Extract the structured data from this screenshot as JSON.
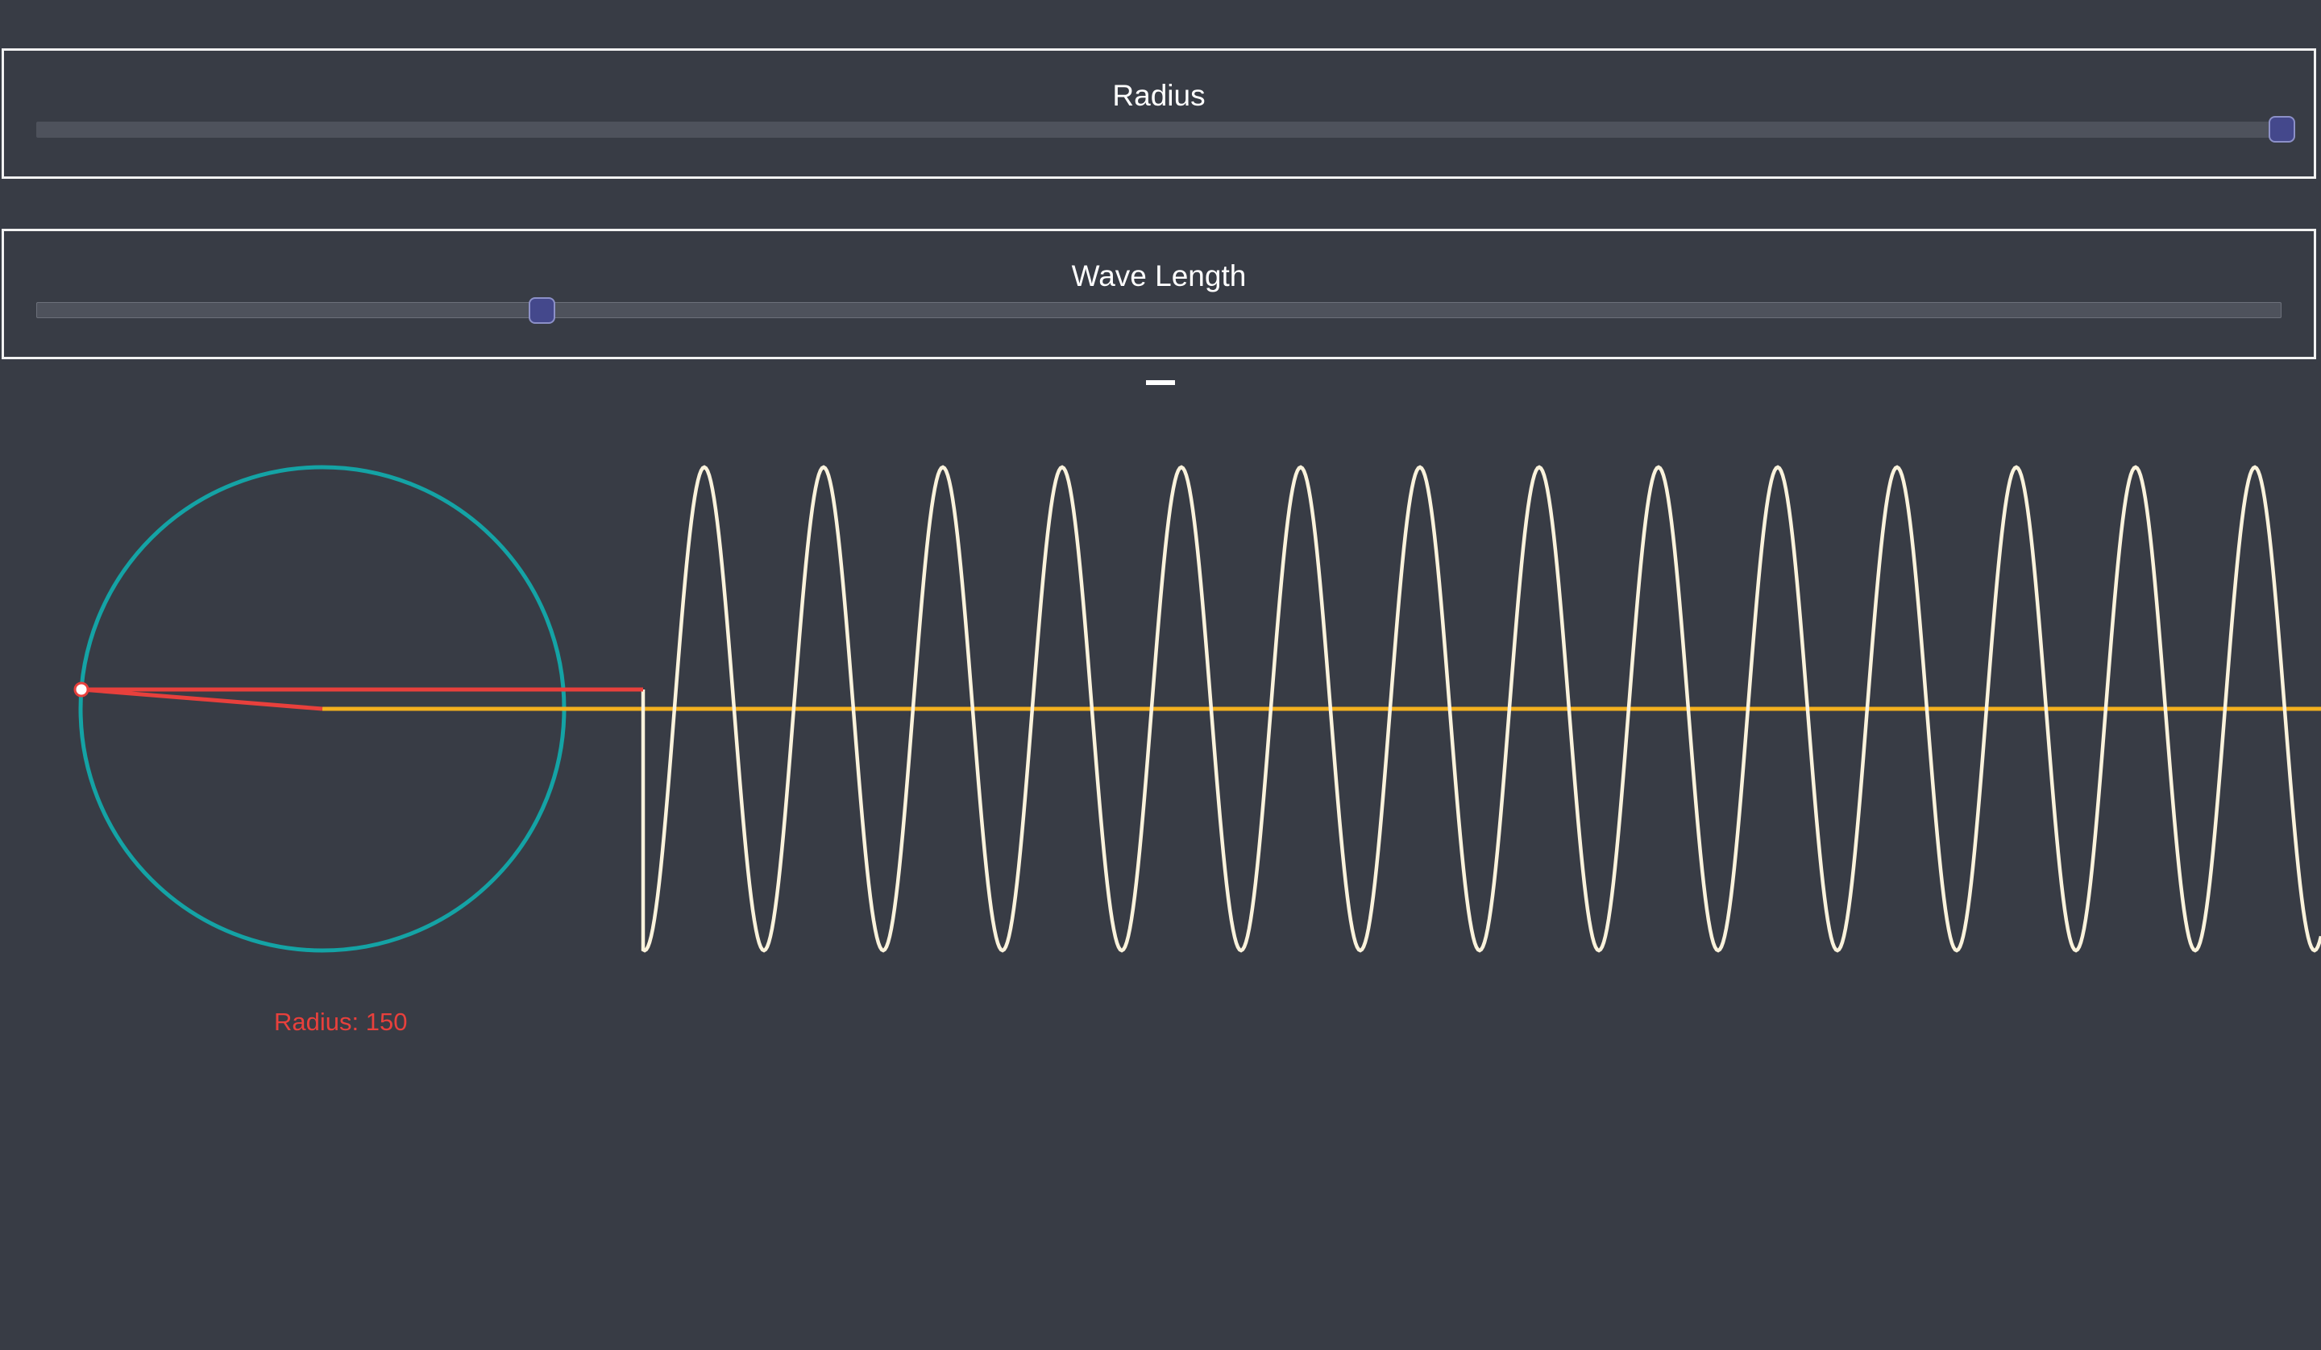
{
  "controls": {
    "radius": {
      "label": "Radius",
      "value_fraction": 1.0
    },
    "wave_length": {
      "label": "Wave Length",
      "value_fraction": 0.225
    }
  },
  "visualization": {
    "radius_label": "Radius: 150",
    "colors": {
      "background": "#383c45",
      "circle": "#14a3a5",
      "radius_line": "#e8403c",
      "sine_wave": "#fbf3dc",
      "axis_line": "#f2b01e",
      "slider_thumb": "#44488c"
    }
  }
}
